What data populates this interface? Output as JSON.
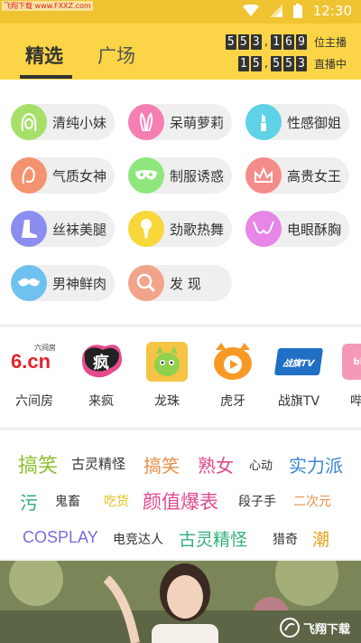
{
  "status_bar": {
    "watermark": "飞翔下载 www.FXXZ.com",
    "time": "12:30"
  },
  "header": {
    "tabs": [
      {
        "label": "精选"
      },
      {
        "label": "广场"
      }
    ],
    "counters": [
      {
        "digits": [
          "5",
          "5",
          "3",
          ",",
          "1",
          "6",
          "9"
        ],
        "label": "位主播"
      },
      {
        "digits": [
          "1",
          "5",
          ",",
          "5",
          "5",
          "3"
        ],
        "label": "直播中"
      }
    ]
  },
  "categories": [
    {
      "label": "清纯小妹",
      "icon": "girl-face-icon",
      "color": "#a6e06a"
    },
    {
      "label": "呆萌萝莉",
      "icon": "bunny-ears-icon",
      "color": "#f57fb2"
    },
    {
      "label": "性感御姐",
      "icon": "lipstick-icon",
      "color": "#5ed2e6"
    },
    {
      "label": "气质女神",
      "icon": "goddess-face-icon",
      "color": "#f49370"
    },
    {
      "label": "制服诱惑",
      "icon": "mask-icon",
      "color": "#8ee67d"
    },
    {
      "label": "高贵女王",
      "icon": "crown-icon",
      "color": "#f48d8a"
    },
    {
      "label": "丝袜美腿",
      "icon": "boot-icon",
      "color": "#8b8df0"
    },
    {
      "label": "劲歌热舞",
      "icon": "microphone-icon",
      "color": "#f7d73a"
    },
    {
      "label": "电眼酥胸",
      "icon": "bra-icon",
      "color": "#e686e6"
    },
    {
      "label": "男神鲜肉",
      "icon": "mustache-icon",
      "color": "#6fc1f0"
    },
    {
      "label": "发 现",
      "icon": "magnifier-icon",
      "color": "#f2a48a"
    }
  ],
  "platforms": [
    {
      "label": "六间房",
      "logo": "6.cn",
      "logo_sub": "六间房"
    },
    {
      "label": "来疯",
      "logo": "疯"
    },
    {
      "label": "龙珠",
      "logo": "dragon"
    },
    {
      "label": "虎牙",
      "logo": "tiger"
    },
    {
      "label": "战旗TV",
      "logo": "战旗TV"
    },
    {
      "label": "哔",
      "logo": "bili"
    }
  ],
  "tags": [
    {
      "text": "搞笑",
      "color": "#8cbf2e",
      "size": 22
    },
    {
      "text": "古灵精怪",
      "color": "#333333",
      "size": 15
    },
    {
      "text": "搞笑",
      "color": "#e88f4a",
      "size": 20
    },
    {
      "text": "熟女",
      "color": "#e04a8c",
      "size": 20
    },
    {
      "text": "心动",
      "color": "#333333",
      "size": 13
    },
    {
      "text": "实力派",
      "color": "#3a86d6",
      "size": 20
    },
    {
      "text": "污",
      "color": "#31a97a",
      "size": 20
    },
    {
      "text": "鬼畜",
      "color": "#333333",
      "size": 14
    },
    {
      "text": "吃货",
      "color": "#e8c21a",
      "size": 14
    },
    {
      "text": "颜值爆表",
      "color": "#e04a8c",
      "size": 21
    },
    {
      "text": "段子手",
      "color": "#333333",
      "size": 14
    },
    {
      "text": "二次元",
      "color": "#e88f4a",
      "size": 14
    },
    {
      "text": "COSPLAY",
      "color": "#7a6ce0",
      "size": 18
    },
    {
      "text": "电竞达人",
      "color": "#333333",
      "size": 14
    },
    {
      "text": "古灵精怪",
      "color": "#31b07a",
      "size": 19
    },
    {
      "text": "猎奇",
      "color": "#333333",
      "size": 14
    },
    {
      "text": "潮",
      "color": "#e8a21a",
      "size": 19
    }
  ],
  "banner": {
    "watermark": "飞翔下载"
  }
}
